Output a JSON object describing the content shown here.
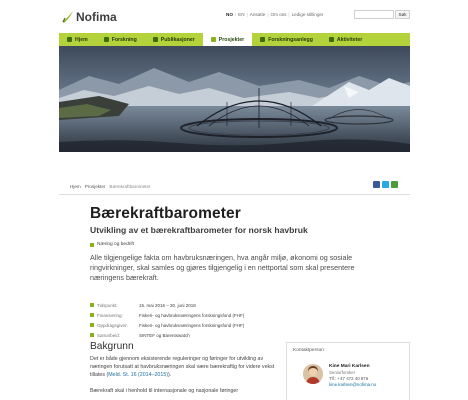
{
  "brand": {
    "logo_text": "Nofima",
    "accent": "#b4d23c"
  },
  "top_links": {
    "lang_no": "NO",
    "lang_en": "EN",
    "links": [
      "Ansatte",
      "Om oss",
      "Ledige stillinger"
    ]
  },
  "search": {
    "button_label": "Søk",
    "placeholder": ""
  },
  "nav": {
    "items": [
      {
        "label": "Hjem",
        "icon": "home-icon",
        "active": false
      },
      {
        "label": "Forskning",
        "icon": "leaf-icon",
        "active": false
      },
      {
        "label": "Publikasjoner",
        "icon": "document-icon",
        "active": false
      },
      {
        "label": "Prosjekter",
        "icon": "folder-icon",
        "active": true
      },
      {
        "label": "Forskningsanlegg",
        "icon": "building-icon",
        "active": false
      },
      {
        "label": "Aktiviteter",
        "icon": "calendar-icon",
        "active": false
      }
    ]
  },
  "breadcrumb": [
    "Hjem",
    "Prosjekter",
    "Bærekraftbarometer"
  ],
  "share": [
    "facebook-icon",
    "twitter-icon",
    "print-icon"
  ],
  "page": {
    "title": "Bærekraftbarometer",
    "subtitle": "Utvikling av et bærekraftbarometer for norsk havbruk",
    "tag": "Næring og bedrift",
    "lead": "Alle tilgjengelige fakta om havbruksnæringen, hva angår miljø, økonomi og sosiale ringvirkninger, skal samles og gjøres tilgjengelig i en nettportal som skal presentere næringens bærekraft."
  },
  "facts": [
    {
      "key": "Tidspunkt:",
      "value": "15. mai 2016 – 30. juni 2018",
      "icon": "clock-icon"
    },
    {
      "key": "Finansiering:",
      "value": "Fiskeri- og havbruksnæringens forskningsfond (FHF)",
      "icon": "money-icon"
    },
    {
      "key": "Oppdragsgiver:",
      "value": "Fiskeri- og havbruksnæringens forskningsfond (FHF)",
      "icon": "person-icon"
    },
    {
      "key": "Samarbeid:",
      "value": "SINTEF og Barentswatch",
      "icon": "handshake-icon"
    }
  ],
  "background": {
    "heading": "Bakgrunn",
    "para1_text": "Det er både gjennom eksisterende reguleringer og føringer for utvikling av næringen forutsatt at havbruksnæringen skal være bærekraftig for videre vekst tillates (",
    "para1_link": "Meld. St. 16 (2014–2015)",
    "para1_end": ").",
    "para2": "Bærekraft skal i henhold til internasjonale og nasjonale føringer"
  },
  "contact": {
    "title": "Kontaktperson",
    "name": "Kine Mari Karlsen",
    "role": "Seniorforsker",
    "phone": "Tlf.: +47 472 40 876",
    "email": "kine.karlsen@nofima.no"
  }
}
